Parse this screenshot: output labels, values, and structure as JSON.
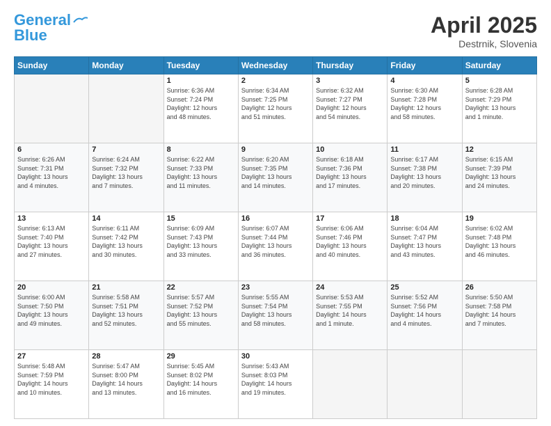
{
  "logo": {
    "line1": "General",
    "line2": "Blue"
  },
  "title": "April 2025",
  "subtitle": "Destrnik, Slovenia",
  "days_of_week": [
    "Sunday",
    "Monday",
    "Tuesday",
    "Wednesday",
    "Thursday",
    "Friday",
    "Saturday"
  ],
  "weeks": [
    [
      {
        "day": "",
        "info": ""
      },
      {
        "day": "",
        "info": ""
      },
      {
        "day": "1",
        "info": "Sunrise: 6:36 AM\nSunset: 7:24 PM\nDaylight: 12 hours\nand 48 minutes."
      },
      {
        "day": "2",
        "info": "Sunrise: 6:34 AM\nSunset: 7:25 PM\nDaylight: 12 hours\nand 51 minutes."
      },
      {
        "day": "3",
        "info": "Sunrise: 6:32 AM\nSunset: 7:27 PM\nDaylight: 12 hours\nand 54 minutes."
      },
      {
        "day": "4",
        "info": "Sunrise: 6:30 AM\nSunset: 7:28 PM\nDaylight: 12 hours\nand 58 minutes."
      },
      {
        "day": "5",
        "info": "Sunrise: 6:28 AM\nSunset: 7:29 PM\nDaylight: 13 hours\nand 1 minute."
      }
    ],
    [
      {
        "day": "6",
        "info": "Sunrise: 6:26 AM\nSunset: 7:31 PM\nDaylight: 13 hours\nand 4 minutes."
      },
      {
        "day": "7",
        "info": "Sunrise: 6:24 AM\nSunset: 7:32 PM\nDaylight: 13 hours\nand 7 minutes."
      },
      {
        "day": "8",
        "info": "Sunrise: 6:22 AM\nSunset: 7:33 PM\nDaylight: 13 hours\nand 11 minutes."
      },
      {
        "day": "9",
        "info": "Sunrise: 6:20 AM\nSunset: 7:35 PM\nDaylight: 13 hours\nand 14 minutes."
      },
      {
        "day": "10",
        "info": "Sunrise: 6:18 AM\nSunset: 7:36 PM\nDaylight: 13 hours\nand 17 minutes."
      },
      {
        "day": "11",
        "info": "Sunrise: 6:17 AM\nSunset: 7:38 PM\nDaylight: 13 hours\nand 20 minutes."
      },
      {
        "day": "12",
        "info": "Sunrise: 6:15 AM\nSunset: 7:39 PM\nDaylight: 13 hours\nand 24 minutes."
      }
    ],
    [
      {
        "day": "13",
        "info": "Sunrise: 6:13 AM\nSunset: 7:40 PM\nDaylight: 13 hours\nand 27 minutes."
      },
      {
        "day": "14",
        "info": "Sunrise: 6:11 AM\nSunset: 7:42 PM\nDaylight: 13 hours\nand 30 minutes."
      },
      {
        "day": "15",
        "info": "Sunrise: 6:09 AM\nSunset: 7:43 PM\nDaylight: 13 hours\nand 33 minutes."
      },
      {
        "day": "16",
        "info": "Sunrise: 6:07 AM\nSunset: 7:44 PM\nDaylight: 13 hours\nand 36 minutes."
      },
      {
        "day": "17",
        "info": "Sunrise: 6:06 AM\nSunset: 7:46 PM\nDaylight: 13 hours\nand 40 minutes."
      },
      {
        "day": "18",
        "info": "Sunrise: 6:04 AM\nSunset: 7:47 PM\nDaylight: 13 hours\nand 43 minutes."
      },
      {
        "day": "19",
        "info": "Sunrise: 6:02 AM\nSunset: 7:48 PM\nDaylight: 13 hours\nand 46 minutes."
      }
    ],
    [
      {
        "day": "20",
        "info": "Sunrise: 6:00 AM\nSunset: 7:50 PM\nDaylight: 13 hours\nand 49 minutes."
      },
      {
        "day": "21",
        "info": "Sunrise: 5:58 AM\nSunset: 7:51 PM\nDaylight: 13 hours\nand 52 minutes."
      },
      {
        "day": "22",
        "info": "Sunrise: 5:57 AM\nSunset: 7:52 PM\nDaylight: 13 hours\nand 55 minutes."
      },
      {
        "day": "23",
        "info": "Sunrise: 5:55 AM\nSunset: 7:54 PM\nDaylight: 13 hours\nand 58 minutes."
      },
      {
        "day": "24",
        "info": "Sunrise: 5:53 AM\nSunset: 7:55 PM\nDaylight: 14 hours\nand 1 minute."
      },
      {
        "day": "25",
        "info": "Sunrise: 5:52 AM\nSunset: 7:56 PM\nDaylight: 14 hours\nand 4 minutes."
      },
      {
        "day": "26",
        "info": "Sunrise: 5:50 AM\nSunset: 7:58 PM\nDaylight: 14 hours\nand 7 minutes."
      }
    ],
    [
      {
        "day": "27",
        "info": "Sunrise: 5:48 AM\nSunset: 7:59 PM\nDaylight: 14 hours\nand 10 minutes."
      },
      {
        "day": "28",
        "info": "Sunrise: 5:47 AM\nSunset: 8:00 PM\nDaylight: 14 hours\nand 13 minutes."
      },
      {
        "day": "29",
        "info": "Sunrise: 5:45 AM\nSunset: 8:02 PM\nDaylight: 14 hours\nand 16 minutes."
      },
      {
        "day": "30",
        "info": "Sunrise: 5:43 AM\nSunset: 8:03 PM\nDaylight: 14 hours\nand 19 minutes."
      },
      {
        "day": "",
        "info": ""
      },
      {
        "day": "",
        "info": ""
      },
      {
        "day": "",
        "info": ""
      }
    ]
  ]
}
